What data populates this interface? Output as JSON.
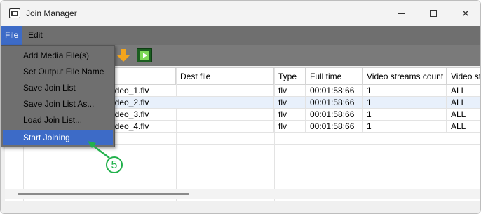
{
  "window": {
    "title": "Join Manager"
  },
  "menubar": {
    "file": "File",
    "edit": "Edit"
  },
  "file_menu": {
    "items": [
      {
        "label": "Add Media File(s)"
      },
      {
        "label": "Set Output File Name"
      },
      {
        "label": "Save Join List"
      },
      {
        "label": "Save Join List As..."
      },
      {
        "label": "Load Join List..."
      },
      {
        "label": "Start Joining",
        "highlighted": true
      }
    ]
  },
  "toolbar": {
    "icons": [
      "arrow-down-icon",
      "film-play-icon"
    ]
  },
  "grid": {
    "columns": [
      "",
      "Dest file",
      "Type",
      "Full time",
      "Video streams count",
      "Video str"
    ],
    "rows": [
      {
        "src": "ideo_1.flv",
        "dest": "",
        "type": "flv",
        "time": "00:01:58:66",
        "count": "1",
        "vstr": "ALL"
      },
      {
        "src": "ideo_2.flv",
        "dest": "",
        "type": "flv",
        "time": "00:01:58:66",
        "count": "1",
        "vstr": "ALL"
      },
      {
        "src": "ideo_3.flv",
        "dest": "",
        "type": "flv",
        "time": "00:01:58:66",
        "count": "1",
        "vstr": "ALL"
      },
      {
        "src": "ideo_4.flv",
        "dest": "",
        "type": "flv",
        "time": "00:01:58:66",
        "count": "1",
        "vstr": "ALL"
      }
    ]
  },
  "annotation": {
    "step": "5",
    "color": "#22b14c"
  },
  "colors": {
    "menu_highlight": "#3d6bc7",
    "menu_bg": "#6f6f6f",
    "row_alt": "#e8f0fb"
  }
}
